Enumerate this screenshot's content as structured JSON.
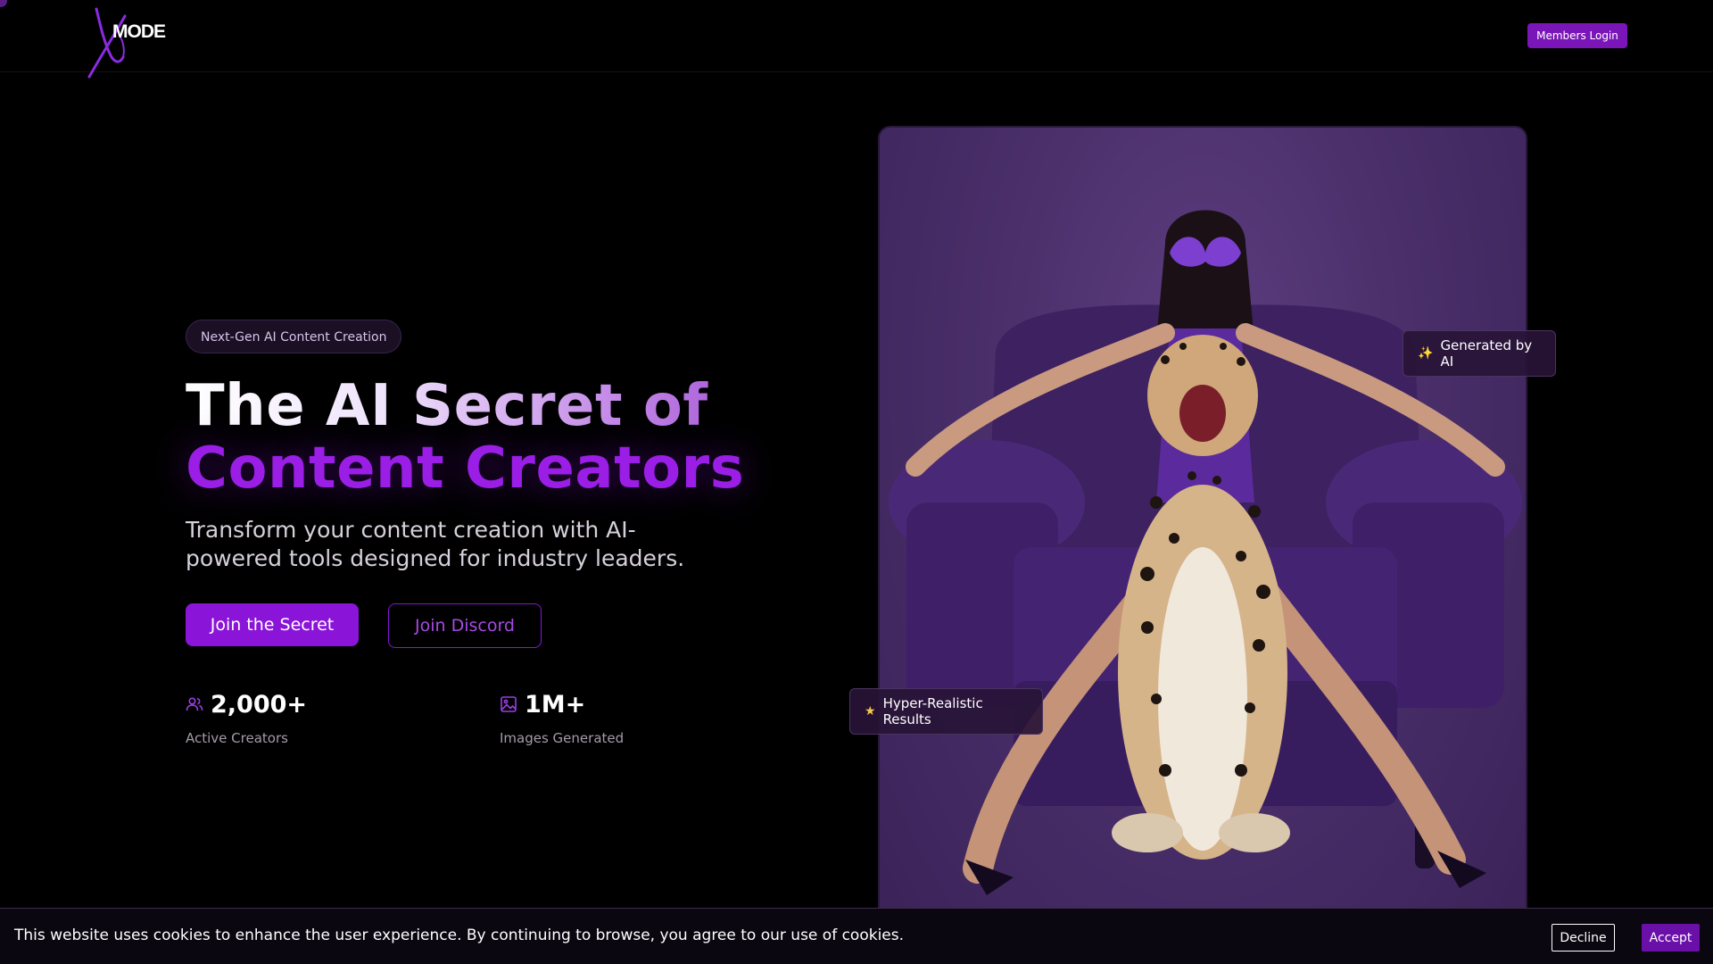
{
  "header": {
    "logo_text": "MODE",
    "logo_mark": "X",
    "members_login_label": "Members Login"
  },
  "hero": {
    "pill_label": "Next-Gen AI Content Creation",
    "headline_line1": "The AI Secret of",
    "headline_line2": "Content Creators",
    "subtitle": "Transform your content creation with AI-powered tools designed for industry leaders.",
    "primary_button_label": "Join the Secret",
    "secondary_button_label": "Join Discord",
    "stats": [
      {
        "icon": "users-icon",
        "value": "2,000+",
        "label": "Active Creators"
      },
      {
        "icon": "image-icon",
        "value": "1M+",
        "label": "Images Generated"
      }
    ],
    "image_badges": {
      "generated": {
        "icon": "sparkles-icon",
        "label": "Generated by AI"
      },
      "realistic": {
        "icon": "star-icon",
        "label": "Hyper-Realistic Results"
      }
    }
  },
  "cookie_banner": {
    "message": "This website uses cookies to enhance the user experience. By continuing to browse, you agree to our use of cookies.",
    "decline_label": "Decline",
    "accept_label": "Accept"
  },
  "colors": {
    "accent": "#8a14d8",
    "background": "#000000",
    "headline_purple": "#9a1ee6"
  }
}
